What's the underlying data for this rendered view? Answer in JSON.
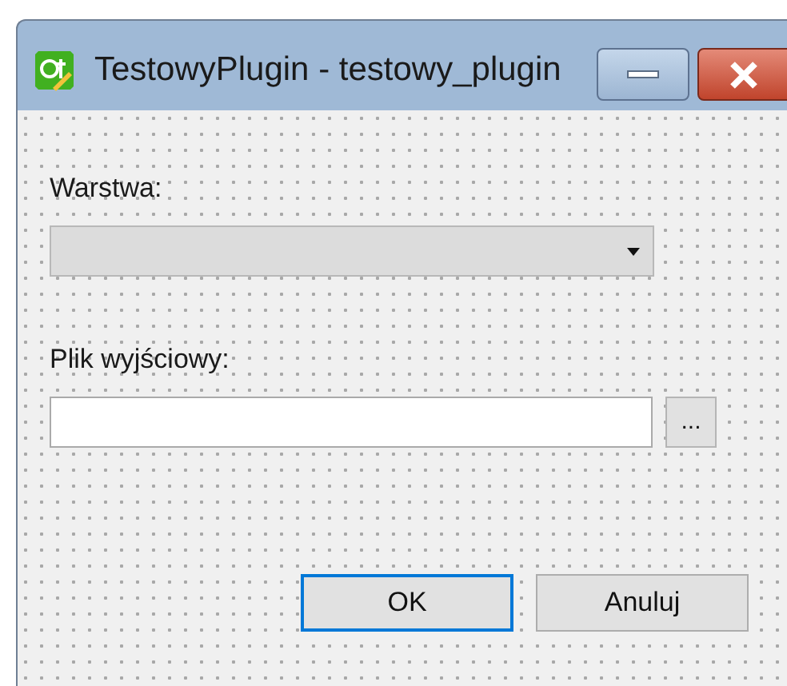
{
  "window": {
    "title": "TestowyPlugin - testowy_plugin"
  },
  "layer": {
    "label": "Warstwa:"
  },
  "output_file": {
    "label": "Plik wyjściowy:",
    "browse_button": "..."
  },
  "buttons": [
    {
      "label": "OK",
      "focused": true
    },
    {
      "label": "Anuluj",
      "focused": false
    }
  ]
}
